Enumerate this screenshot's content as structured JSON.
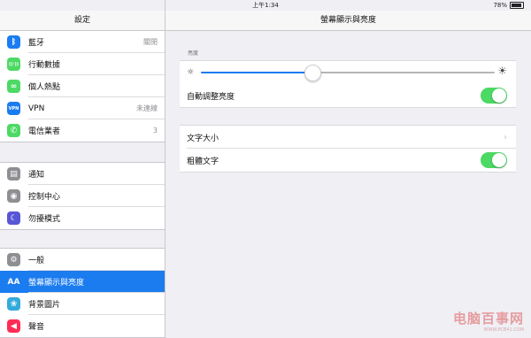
{
  "status": {
    "time": "上午1:34",
    "battery": "78%",
    "battery_level": 0.78
  },
  "left": {
    "title": "設定",
    "group1": [
      {
        "label": "藍牙",
        "value": "關閉",
        "icon": "bluetooth-icon",
        "color": "#1a7cf0",
        "glyph": "ᛒ"
      },
      {
        "label": "行動數據",
        "value": "",
        "icon": "antenna-icon",
        "color": "#4cd964",
        "glyph": "((·))"
      },
      {
        "label": "個人熱點",
        "value": "",
        "icon": "hotspot-icon",
        "color": "#4cd964",
        "glyph": "∞"
      },
      {
        "label": "VPN",
        "value": "未連線",
        "icon": "vpn-icon",
        "color": "#1a7cf0",
        "glyph": "VPN"
      },
      {
        "label": "電信業者",
        "value": "3",
        "icon": "phone-icon",
        "color": "#4cd964",
        "glyph": "✆"
      }
    ],
    "group2": [
      {
        "label": "通知",
        "value": "",
        "icon": "notifications-icon",
        "color": "#8e8e93",
        "glyph": "▤"
      },
      {
        "label": "控制中心",
        "value": "",
        "icon": "control-center-icon",
        "color": "#8e8e93",
        "glyph": "◉"
      },
      {
        "label": "勿擾模式",
        "value": "",
        "icon": "moon-icon",
        "color": "#5856d6",
        "glyph": "☾"
      }
    ],
    "group3": [
      {
        "label": "一般",
        "value": "",
        "icon": "gear-icon",
        "color": "#8e8e93",
        "glyph": "⚙"
      },
      {
        "label": "螢幕顯示與亮度",
        "value": "",
        "icon": "text-size-icon",
        "color": "#1a7cf0",
        "glyph": "AA",
        "selected": true
      },
      {
        "label": "背景圖片",
        "value": "",
        "icon": "wallpaper-icon",
        "color": "#34aadc",
        "glyph": "❀"
      },
      {
        "label": "聲音",
        "value": "",
        "icon": "speaker-icon",
        "color": "#ff2d55",
        "glyph": "◀"
      }
    ]
  },
  "right": {
    "title": "螢幕顯示與亮度",
    "brightness_section": "亮度",
    "brightness_level": 0.38,
    "auto_brightness_label": "自動調整亮度",
    "auto_brightness_on": true,
    "text_size_label": "文字大小",
    "bold_text_label": "粗體文字",
    "bold_text_on": true
  },
  "watermark": {
    "text": "电脑百事网",
    "sub": "WWW.PCB41.COM"
  }
}
